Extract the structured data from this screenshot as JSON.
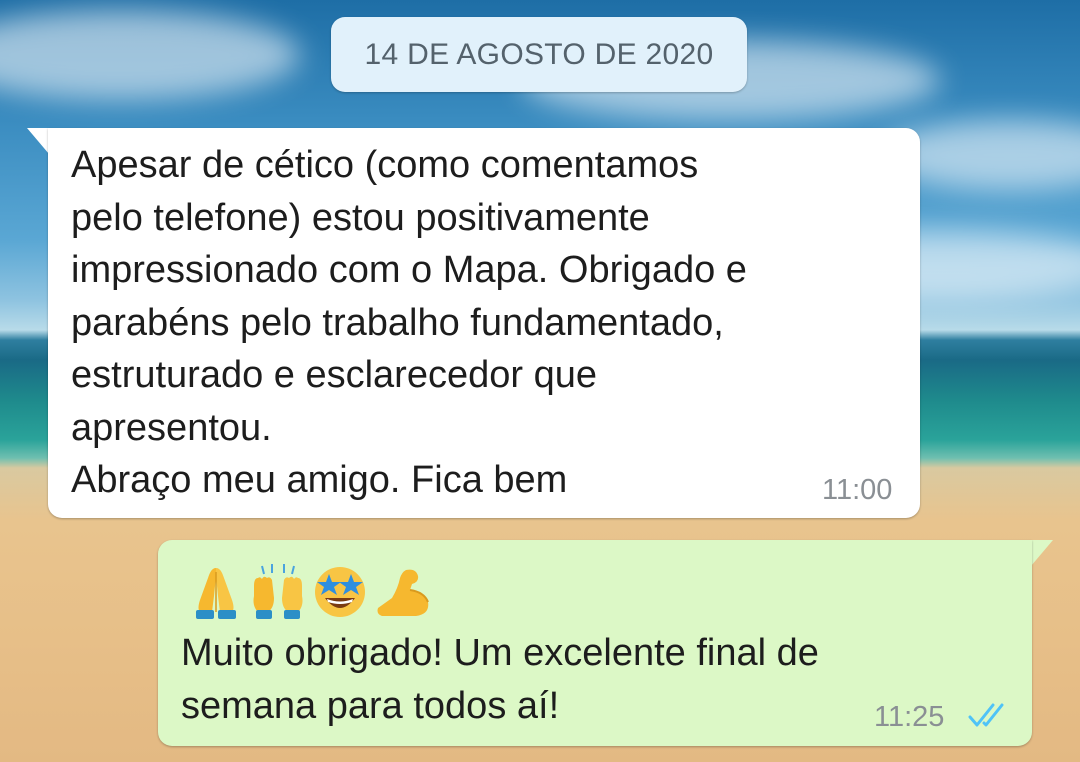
{
  "wallpaper": {
    "description_colors": {
      "sky": "#3a8cc0",
      "sea": "#1e8a8c",
      "sand": "#e7bf88"
    }
  },
  "date_chip": {
    "label": "14 DE AGOSTO DE 2020"
  },
  "messages": [
    {
      "direction": "incoming",
      "text": "Apesar de cético (como comentamos\npelo telefone) estou positivamente\nimpressionado com o Mapa. Obrigado e\nparabéns pelo trabalho fundamentado,\nestruturado e esclarecedor que\napresentou.\nAbraço meu amigo. Fica bem",
      "time": "11:00",
      "bubble_color": "#ffffff"
    },
    {
      "direction": "outgoing",
      "emojis": [
        "folded-hands-emoji",
        "raising-hands-emoji",
        "star-struck-emoji",
        "flexed-biceps-emoji"
      ],
      "text": "Muito obrigado! Um excelente final de\nsemana para todos aí!",
      "time": "11:25",
      "status": "read-double-check-icon",
      "bubble_color": "#dcf8c6",
      "status_color": "#4fc3f7"
    }
  ]
}
